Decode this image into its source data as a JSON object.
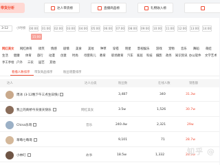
{
  "toolbar": {
    "ranking": "带货分析",
    "btn1": "达人带货榜",
    "btn2": "直播商品榜",
    "btn3": "礼物收入榜",
    "btn4": ""
  },
  "date": {
    "value": "3-12",
    "realtime": "小时榜",
    "hours_row1": [
      "00:00",
      "01:00",
      "02:00",
      "03:00",
      "04:00",
      "05:00",
      "06:00",
      "07:00",
      "08:00",
      "09:00",
      "10:00",
      "11:00",
      "12:00",
      "13:00",
      "14:00"
    ],
    "hours_row2": [
      "15:00"
    ]
  },
  "categories_row1": [
    "网红美女",
    "网红帅哥",
    "搞笑",
    "情感",
    "剧情",
    "美食",
    "美妆",
    "种草",
    "穿搭",
    "明星",
    "影视娱乐",
    "游戏",
    "宠物",
    "音乐",
    "舞蹈",
    "萌娃"
  ],
  "categories_row2": [
    "生活",
    "健康",
    "体育",
    "旅行",
    "动漫",
    "创意",
    "时尚",
    "母婴育儿",
    "教育",
    "职场教育",
    "汽车",
    "家居",
    "科技",
    "摄影",
    "政务",
    "知识资讯",
    "办公软件",
    "文学艺术"
  ],
  "categories_row3": [
    "手工手绘",
    "户外",
    "三农",
    "园艺",
    "其他"
  ],
  "tabs": [
    "看播人数排序",
    "带货商品排序",
    "粉丝增量排序"
  ],
  "table": {
    "headers": [
      "达人",
      "达人分类",
      "粉丝数",
      "在线人数",
      "销售额"
    ],
    "rows": [
      {
        "name": "周冰 (3-12晚下午三点生日快)",
        "category": "",
        "fans": "3,487",
        "online": "340",
        "sales": "31.3w"
      },
      {
        "name": "我上的商桥今天很天快乐",
        "category": "网红美女",
        "fans": "3.5w",
        "online": "1,526",
        "sales": "30.7w"
      },
      {
        "name": "China乐哥",
        "category": "音乐",
        "fans": "240.4w",
        "online": "2,321",
        "sales": "29w"
      },
      {
        "name": "草莓七莓哥",
        "category": "",
        "fans": "9,101",
        "online": "71",
        "sales": "28.7w"
      },
      {
        "name": "小林叮",
        "category": "故事",
        "fans": "18.5w",
        "online": "1,332",
        "sales": "28.5w"
      }
    ]
  },
  "watermark": "知乎 @"
}
